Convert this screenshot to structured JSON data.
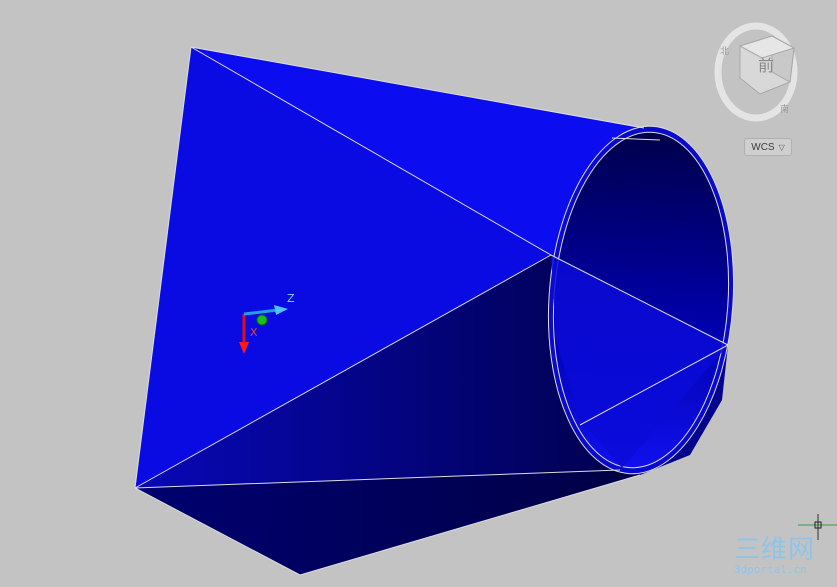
{
  "viewcube": {
    "face_label": "前",
    "coord_system": "WCS"
  },
  "ucs": {
    "z_label": "Z",
    "x_label": "X"
  },
  "watermark": {
    "main": "三维网",
    "sub": "3dportal.cn"
  },
  "colors": {
    "background": "#c3c3c3",
    "solid_light": "#0a0ae6",
    "solid_dark": "#000060",
    "edges": "#dcdcdc"
  }
}
